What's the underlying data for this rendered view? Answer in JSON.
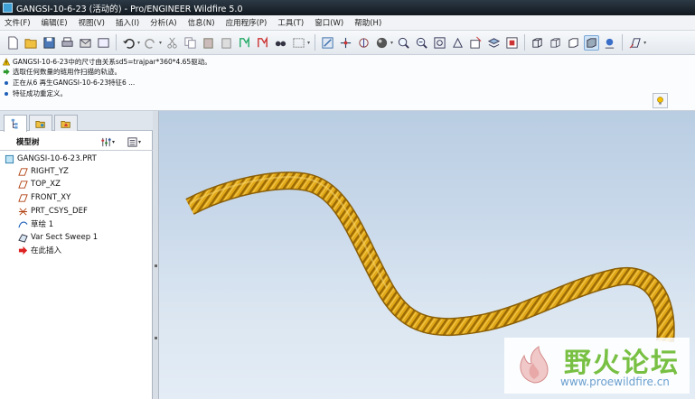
{
  "window": {
    "title": "GANGSI-10-6-23 (活动的) - Pro/ENGINEER Wildfire 5.0"
  },
  "menu": [
    "文件(F)",
    "编辑(E)",
    "视图(V)",
    "插入(I)",
    "分析(A)",
    "信息(N)",
    "应用程序(P)",
    "工具(T)",
    "窗口(W)",
    "帮助(H)"
  ],
  "toolbar_icons": [
    "new-file-icon",
    "open-file-icon",
    "save-icon",
    "print-icon",
    "email-icon",
    "undo-icon",
    "redo-icon",
    "cut-icon",
    "copy-icon",
    "paste-icon",
    "regenerate-icon",
    "find-icon",
    "select-box-icon",
    "repaint-icon",
    "spin-center-icon",
    "orient-icon",
    "appearance-icon",
    "zoom-in-icon",
    "zoom-out-icon",
    "refit-icon",
    "view-manager-icon",
    "layers-icon",
    "saved-views-icon",
    "wireframe-icon",
    "hidden-line-icon",
    "no-hidden-icon",
    "shading-icon",
    "datum-plane-icon"
  ],
  "messages": [
    {
      "icon": "warning-icon",
      "text": "GANGSI-10-6-23中的尺寸由关系sd5=trajpar*360*4.65驱动。"
    },
    {
      "icon": "arrow-icon",
      "text": "选取任何数量的链用作扫描的轨迹。"
    },
    {
      "icon": "bullet-icon",
      "text": "正在从6 再生GANGSI-10-6-23特征6 ..."
    },
    {
      "icon": "bullet-icon",
      "text": "特征成功重定义。"
    }
  ],
  "model_tree": {
    "header": "模型树",
    "nodes": [
      {
        "icon": "part-icon",
        "label": "GANGSI-10-6-23.PRT"
      },
      {
        "icon": "datum-plane-icon",
        "label": "RIGHT_YZ"
      },
      {
        "icon": "datum-plane-icon",
        "label": "TOP_XZ"
      },
      {
        "icon": "datum-plane-icon",
        "label": "FRONT_XY"
      },
      {
        "icon": "csys-icon",
        "label": "PRT_CSYS_DEF"
      },
      {
        "icon": "sketch-icon",
        "label": "草绘 1"
      },
      {
        "icon": "sweep-icon",
        "label": "Var Sect Sweep 1"
      },
      {
        "icon": "insert-here-icon",
        "label": "在此插入"
      }
    ]
  },
  "watermark": {
    "text": "野火论坛",
    "url": "www.proewildfire.cn"
  },
  "colors": {
    "rope": "#e0a616",
    "rope_dark": "#b07c08",
    "viewport_top": "#b9cde2",
    "viewport_bottom": "#e4edf6"
  }
}
